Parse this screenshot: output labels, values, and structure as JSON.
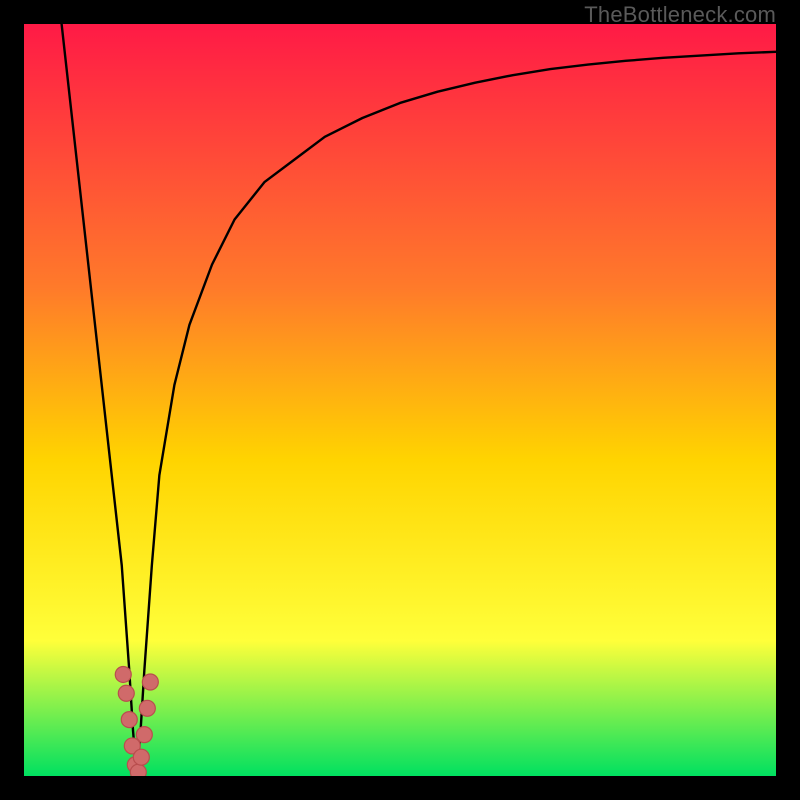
{
  "watermark": "TheBottleneck.com",
  "colors": {
    "frame": "#000000",
    "gradient_top": "#ff1a46",
    "gradient_mid1": "#ff7a2a",
    "gradient_mid2": "#ffd400",
    "gradient_mid3": "#ffff3a",
    "gradient_bottom": "#00e060",
    "curve": "#000000",
    "marker_fill": "#d06a6a",
    "marker_stroke": "#b94e4e"
  },
  "chart_data": {
    "type": "line",
    "title": "",
    "xlabel": "",
    "ylabel": "",
    "xlim": [
      0,
      100
    ],
    "ylim": [
      0,
      100
    ],
    "note": "Axis values are estimated from pixel positions; the image has no visible tick labels or axis text.",
    "series": [
      {
        "name": "bottleneck-curve",
        "x": [
          5,
          7,
          9,
          11,
          13,
          14,
          14.5,
          15,
          15.5,
          16,
          17,
          18,
          20,
          22,
          25,
          28,
          32,
          36,
          40,
          45,
          50,
          55,
          60,
          65,
          70,
          75,
          80,
          85,
          90,
          95,
          100
        ],
        "y": [
          100,
          82,
          64,
          46,
          28,
          14,
          6,
          0,
          6,
          14,
          28,
          40,
          52,
          60,
          68,
          74,
          79,
          82,
          85,
          87.5,
          89.5,
          91,
          92.2,
          93.2,
          94,
          94.6,
          95.1,
          95.5,
          95.8,
          96.1,
          96.3
        ]
      }
    ],
    "markers": {
      "name": "highlighted-points",
      "points": [
        {
          "x": 13.2,
          "y": 13.5
        },
        {
          "x": 13.6,
          "y": 11.0
        },
        {
          "x": 14.0,
          "y": 7.5
        },
        {
          "x": 14.4,
          "y": 4.0
        },
        {
          "x": 14.8,
          "y": 1.5
        },
        {
          "x": 15.2,
          "y": 0.5
        },
        {
          "x": 15.6,
          "y": 2.5
        },
        {
          "x": 16.0,
          "y": 5.5
        },
        {
          "x": 16.4,
          "y": 9.0
        },
        {
          "x": 16.8,
          "y": 12.5
        }
      ]
    }
  }
}
